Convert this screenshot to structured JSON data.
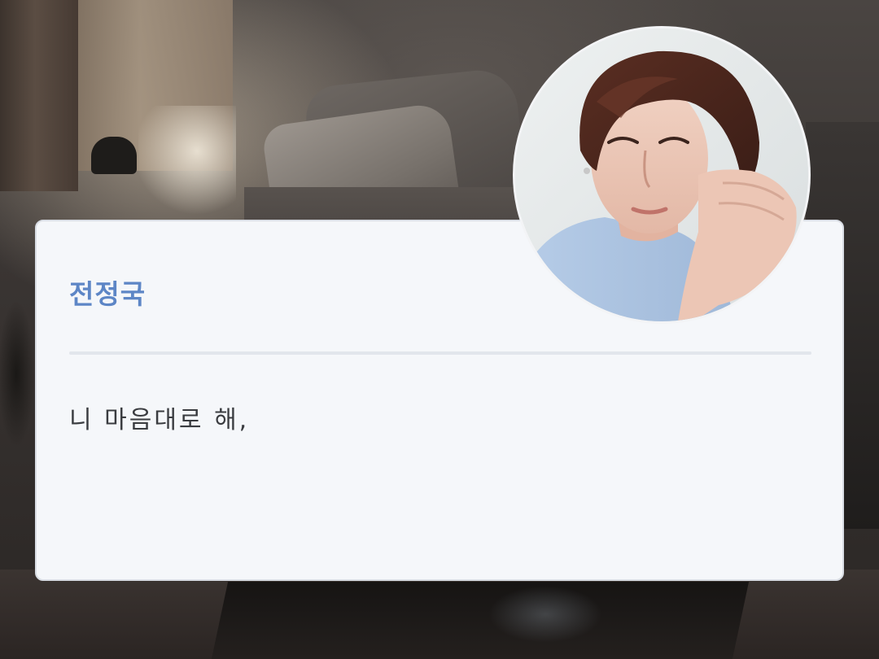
{
  "profile": {
    "name": "전정국",
    "message": "니 마음대로 해,",
    "avatar_icon": "profile-photo"
  },
  "colors": {
    "card_background": "#f5f7fa",
    "name_accent": "#5d86c6",
    "message_text": "#3a3c40",
    "divider": "#e2e6ec"
  }
}
